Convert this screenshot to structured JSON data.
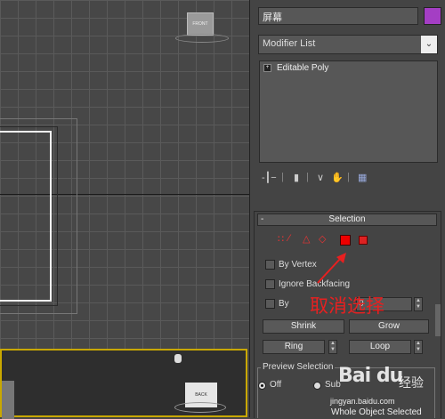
{
  "viewport": {
    "viewcube_top_label": "FRONT",
    "viewcube_bottom_label": "BACK"
  },
  "command_panel": {
    "object_name": "屏幕",
    "object_color": "#a43ec4",
    "modifier_list_label": "Modifier List",
    "stack_items": [
      {
        "label": "Editable Poly"
      }
    ]
  },
  "selection_rollout": {
    "title": "Selection",
    "collapse_glyph": "-",
    "by_vertex_label": "By Vertex",
    "ignore_backfacing_label": "Ignore Backfacing",
    "by_angle_label_visible": "By",
    "angle_value": "0",
    "shrink_label": "Shrink",
    "grow_label": "Grow",
    "ring_label": "Ring",
    "loop_label": "Loop",
    "preview_group_title": "Preview Selection",
    "preview_off_label": "Off",
    "preview_subobj_label": "Sub",
    "status_text": "Whole Object Selected"
  },
  "annotation": {
    "text": "取消选择",
    "color": "#e82020"
  },
  "watermark": {
    "logo_text": "Bai du",
    "text": "经验",
    "url": "jingyan.baidu.com"
  },
  "icons": [
    "pin-stack-icon",
    "show-end-result-icon",
    "make-unique-icon",
    "remove-modifier-icon",
    "configure-modifier-sets-icon",
    "vertex-icon",
    "edge-icon",
    "border-icon",
    "polygon-icon",
    "element-icon"
  ]
}
